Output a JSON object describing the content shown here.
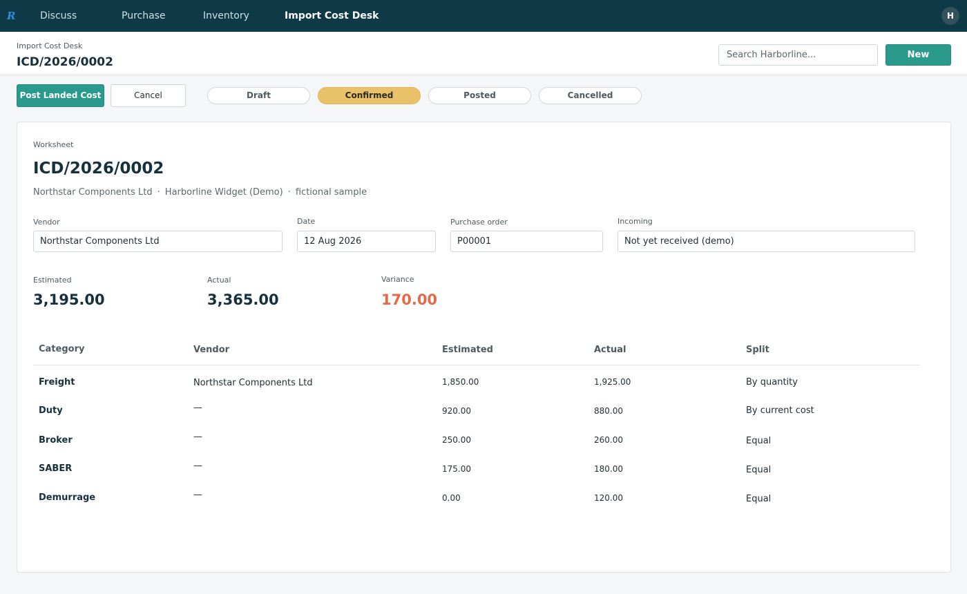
{
  "nav": {
    "logo": "R",
    "items": [
      "Discuss",
      "Purchase",
      "Inventory"
    ],
    "active": "Import Cost Desk",
    "avatar": "H"
  },
  "header": {
    "breadcrumb": "Import Cost Desk",
    "title": "ICD/2026/0002",
    "search_placeholder": "Search Harborline...",
    "new_label": "New"
  },
  "actions": {
    "post_label": "Post Landed Cost",
    "cancel_label": "Cancel"
  },
  "stages": [
    {
      "label": "Draft",
      "active": false
    },
    {
      "label": "Confirmed",
      "active": true
    },
    {
      "label": "Posted",
      "active": false
    },
    {
      "label": "Cancelled",
      "active": false
    }
  ],
  "sheet": {
    "label": "Worksheet",
    "title": "ICD/2026/0002",
    "meta": [
      "Northstar Components Ltd",
      "Harborline Widget (Demo)",
      "fictional sample"
    ],
    "meta_sep": "·"
  },
  "fields": {
    "vendor": {
      "label": "Vendor",
      "value": "Northstar Components Ltd"
    },
    "date": {
      "label": "Date",
      "value": "12 Aug 2026"
    },
    "po": {
      "label": "Purchase order",
      "value": "P00001"
    },
    "incoming": {
      "label": "Incoming",
      "value": "Not yet received (demo)"
    }
  },
  "kpis": {
    "estimated": {
      "label": "Estimated",
      "value": "3,195.00"
    },
    "actual": {
      "label": "Actual",
      "value": "3,365.00"
    },
    "variance": {
      "label": "Variance",
      "value": "170.00",
      "color": "#e06a4a"
    }
  },
  "table": {
    "headers": [
      "Category",
      "Vendor",
      "Estimated",
      "Actual",
      "Split"
    ],
    "rows": [
      {
        "category": "Freight",
        "vendor": "Northstar Components Ltd",
        "estimated": "1,850.00",
        "actual": "1,925.00",
        "split": "By quantity"
      },
      {
        "category": "Duty",
        "vendor": "—",
        "estimated": "920.00",
        "actual": "880.00",
        "split": "By current cost"
      },
      {
        "category": "Broker",
        "vendor": "—",
        "estimated": "250.00",
        "actual": "260.00",
        "split": "Equal"
      },
      {
        "category": "SABER",
        "vendor": "—",
        "estimated": "175.00",
        "actual": "180.00",
        "split": "Equal"
      },
      {
        "category": "Demurrage",
        "vendor": "—",
        "estimated": "0.00",
        "actual": "120.00",
        "split": "Equal"
      }
    ]
  },
  "colors": {
    "topbar": "#0e3a48",
    "accent": "#2a9a8c",
    "active_stage": "#e8c16a",
    "variance": "#e06a4a"
  }
}
